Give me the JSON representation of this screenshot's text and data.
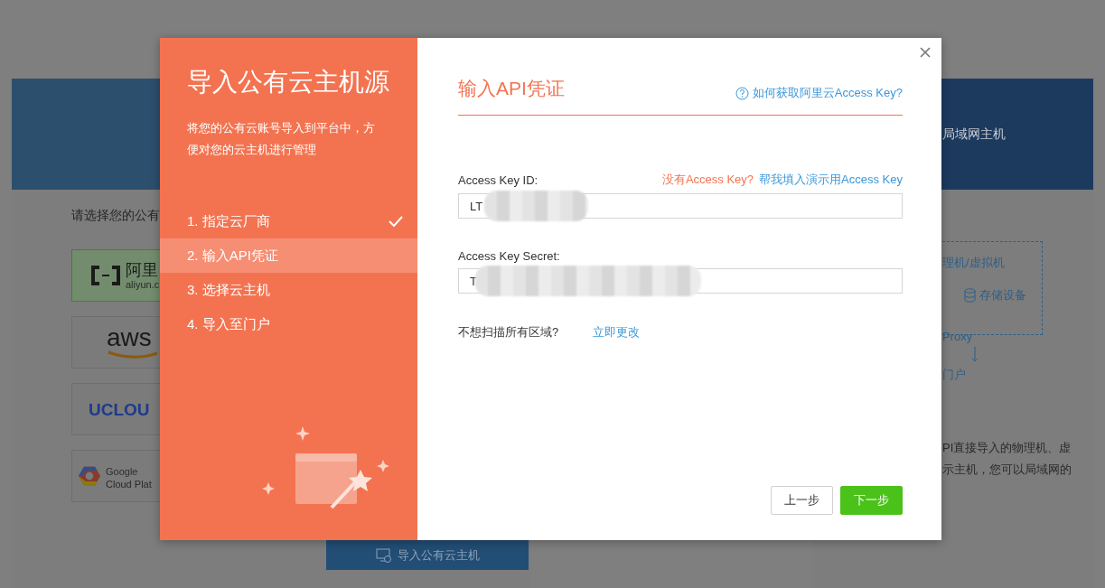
{
  "background": {
    "left_card": {
      "prompt": "请选择您的公有",
      "providers": [
        {
          "kind": "aliyun",
          "label": "阿里",
          "sublabel": "aliyun.c",
          "selected": true
        },
        {
          "kind": "aws",
          "label": "aws",
          "selected": false
        },
        {
          "kind": "ucloud",
          "label": "UCLOU",
          "selected": false
        },
        {
          "kind": "google",
          "label": "Google",
          "sublabel": "Cloud Plat",
          "selected": false
        }
      ],
      "button": "导入公有云主机"
    },
    "right_card": {
      "header": "局域网主机",
      "diagram": {
        "hosts": "理机/虚拟机",
        "storage": "存储设备",
        "proxy": "Proxy",
        "portal": "门户"
      },
      "description": [
        "PI直接导入的物理机、虚",
        "示主机，您可以局域网的"
      ]
    }
  },
  "modal": {
    "title": "导入公有云主机源",
    "subtitle": "将您的公有云账号导入到平台中，方便对您的云主机进行管理",
    "steps": [
      {
        "label": "1. 指定云厂商",
        "done": true,
        "selected": false
      },
      {
        "label": "2. 输入API凭证",
        "done": false,
        "selected": true
      },
      {
        "label": "3. 选择云主机",
        "done": false,
        "selected": false
      },
      {
        "label": "4. 导入至门户",
        "done": false,
        "selected": false
      }
    ],
    "heading": "输入API凭证",
    "help_link": "如何获取阿里云Access Key?",
    "fields": [
      {
        "label": "Access Key ID:",
        "value": "LT",
        "redacted": true,
        "links": [
          {
            "text": "没有Access Key?",
            "kind": "warning"
          },
          {
            "text": "帮我填入演示用Access Key",
            "kind": "link"
          }
        ]
      },
      {
        "label": "Access Key Secret:",
        "value": "T",
        "redacted": true
      }
    ],
    "region_prompt": "不想扫描所有区域?",
    "region_link": "立即更改",
    "buttons": [
      {
        "label": "上一步",
        "kind": "secondary"
      },
      {
        "label": "下一步",
        "kind": "primary"
      }
    ]
  }
}
